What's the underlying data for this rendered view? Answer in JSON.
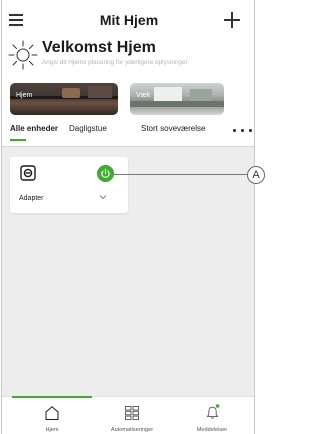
{
  "header": {
    "app_title": "Mit Hjem",
    "welcome_title": "Velkomst Hjem",
    "location_hint": "Angiv dit Hjems placering for yderligere oplysninger."
  },
  "rooms": [
    {
      "label": "Hjem"
    },
    {
      "label": "Væk"
    }
  ],
  "tabs": [
    {
      "label": "Alle enheder",
      "active": true
    },
    {
      "label": "Dagligstue"
    },
    {
      "label": "Stort soveværelse"
    }
  ],
  "devices": [
    {
      "name": "Adapter",
      "power_state": "on",
      "power_color": "#3dae2b"
    }
  ],
  "callout": {
    "label": "A"
  },
  "bottom_nav": [
    {
      "label": "Hjem",
      "icon": "home-icon",
      "active": true
    },
    {
      "label": "Automatiseringer",
      "icon": "grid-icon"
    },
    {
      "label": "Meddelelser",
      "icon": "bell-icon",
      "badge": true
    }
  ],
  "colors": {
    "accent": "#3dae2b",
    "content_background": "#ededed",
    "hint_text": "#b4b4b4"
  }
}
